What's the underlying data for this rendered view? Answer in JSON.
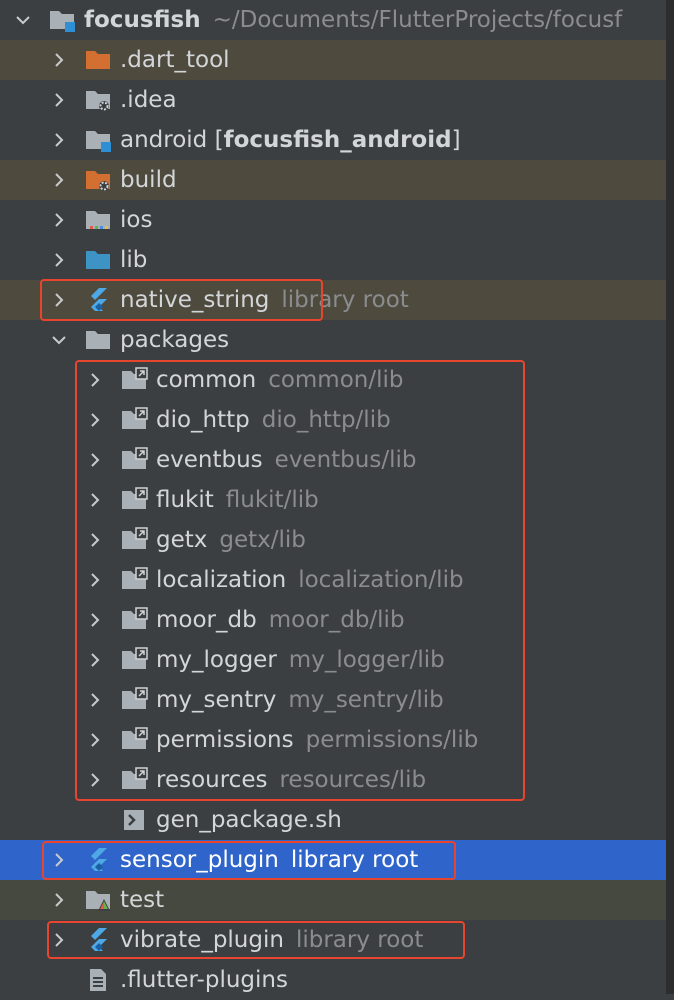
{
  "colors": {
    "panel_bg": "#3c3f41",
    "excluded_row": "#4e4a3e",
    "selected_row": "#2f65ca",
    "test_row": "#45493f",
    "highlight_frame": "#e8452f",
    "module_square": "#2f8fd5",
    "excluded_folder": "#d36f31",
    "flutter_blue": "#4fa8e6"
  },
  "tree": [
    {
      "depth": 0,
      "expand": "open",
      "icon": "module-folder-icon",
      "name": "focusfish",
      "bold": true,
      "hint": "~/Documents/FlutterProjects/focusf",
      "bg": "none"
    },
    {
      "depth": 1,
      "expand": "closed",
      "icon": "excluded-folder-icon",
      "name": ".dart_tool",
      "hint": "",
      "bg": "excluded"
    },
    {
      "depth": 1,
      "expand": "closed",
      "icon": "settings-folder-icon",
      "name": ".idea",
      "hint": "",
      "bg": "none"
    },
    {
      "depth": 1,
      "expand": "closed",
      "icon": "module-folder-icon",
      "name": "android",
      "suffix_open": " [",
      "suffix_bold": "focusfish_android",
      "suffix_close": "]",
      "hint": "",
      "bg": "none"
    },
    {
      "depth": 1,
      "expand": "closed",
      "icon": "excluded-settings-folder-icon",
      "name": "build",
      "hint": "",
      "bg": "excluded"
    },
    {
      "depth": 1,
      "expand": "closed",
      "icon": "ios-folder-icon",
      "name": "ios",
      "hint": "",
      "bg": "none"
    },
    {
      "depth": 1,
      "expand": "closed",
      "icon": "source-folder-icon",
      "name": "lib",
      "hint": "",
      "bg": "none"
    },
    {
      "depth": 1,
      "expand": "closed",
      "icon": "flutter-icon",
      "name": "native_string",
      "hint": "library root",
      "bg": "excluded"
    },
    {
      "depth": 1,
      "expand": "open",
      "icon": "folder-icon",
      "name": "packages",
      "hint": "",
      "bg": "none"
    },
    {
      "depth": 2,
      "expand": "closed",
      "icon": "symlink-folder-icon",
      "name": "common",
      "hint": "common/lib",
      "bg": "none"
    },
    {
      "depth": 2,
      "expand": "closed",
      "icon": "symlink-folder-icon",
      "name": "dio_http",
      "hint": "dio_http/lib",
      "bg": "none"
    },
    {
      "depth": 2,
      "expand": "closed",
      "icon": "symlink-folder-icon",
      "name": "eventbus",
      "hint": "eventbus/lib",
      "bg": "none"
    },
    {
      "depth": 2,
      "expand": "closed",
      "icon": "symlink-folder-icon",
      "name": "flukit",
      "hint": "flukit/lib",
      "bg": "none"
    },
    {
      "depth": 2,
      "expand": "closed",
      "icon": "symlink-folder-icon",
      "name": "getx",
      "hint": "getx/lib",
      "bg": "none"
    },
    {
      "depth": 2,
      "expand": "closed",
      "icon": "symlink-folder-icon",
      "name": "localization",
      "hint": "localization/lib",
      "bg": "none"
    },
    {
      "depth": 2,
      "expand": "closed",
      "icon": "symlink-folder-icon",
      "name": "moor_db",
      "hint": "moor_db/lib",
      "bg": "none"
    },
    {
      "depth": 2,
      "expand": "closed",
      "icon": "symlink-folder-icon",
      "name": "my_logger",
      "hint": "my_logger/lib",
      "bg": "none"
    },
    {
      "depth": 2,
      "expand": "closed",
      "icon": "symlink-folder-icon",
      "name": "my_sentry",
      "hint": "my_sentry/lib",
      "bg": "none"
    },
    {
      "depth": 2,
      "expand": "closed",
      "icon": "symlink-folder-icon",
      "name": "permissions",
      "hint": "permissions/lib",
      "bg": "none"
    },
    {
      "depth": 2,
      "expand": "closed",
      "icon": "symlink-folder-icon",
      "name": "resources",
      "hint": "resources/lib",
      "bg": "none"
    },
    {
      "depth": 2,
      "expand": "none",
      "icon": "shell-script-icon",
      "name": "gen_package.sh",
      "hint": "",
      "bg": "none"
    },
    {
      "depth": 1,
      "expand": "closed",
      "icon": "flutter-icon",
      "name": "sensor_plugin",
      "hint": "library root",
      "bg": "selected"
    },
    {
      "depth": 1,
      "expand": "closed",
      "icon": "test-folder-icon",
      "name": "test",
      "hint": "",
      "bg": "test"
    },
    {
      "depth": 1,
      "expand": "closed",
      "icon": "flutter-icon",
      "name": "vibrate_plugin",
      "hint": "library root",
      "bg": "none"
    },
    {
      "depth": 1,
      "expand": "none",
      "icon": "text-file-icon",
      "name": ".flutter-plugins",
      "hint": "",
      "bg": "none"
    }
  ]
}
